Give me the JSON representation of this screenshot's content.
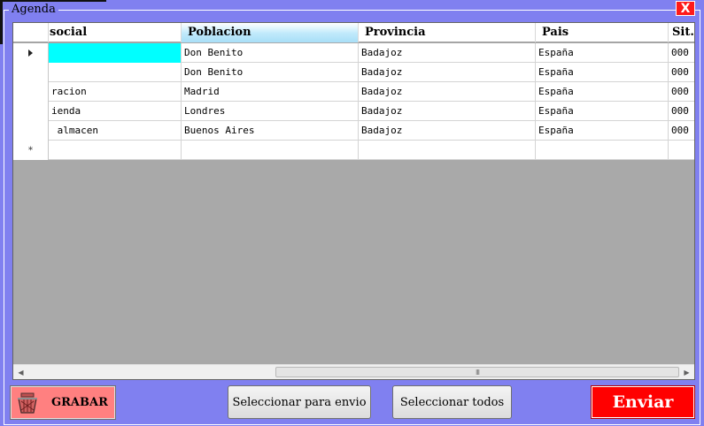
{
  "window": {
    "group_title": "Agenda",
    "close_label": "X"
  },
  "grid": {
    "columns": [
      {
        "label": "social",
        "sorted": false
      },
      {
        "label": "Poblacion",
        "sorted": true
      },
      {
        "label": "Provincia",
        "sorted": false
      },
      {
        "label": "Pais",
        "sorted": false
      },
      {
        "label": "Sit.",
        "sorted": false
      }
    ],
    "rows": [
      {
        "marker": "current",
        "social": "",
        "poblacion": "Don Benito",
        "provincia": "Badajoz",
        "pais": "España",
        "sit": "000"
      },
      {
        "marker": "",
        "social": "",
        "poblacion": "Don Benito",
        "provincia": "Badajoz",
        "pais": "España",
        "sit": "000"
      },
      {
        "marker": "",
        "social": "racion",
        "poblacion": "Madrid",
        "provincia": "Badajoz",
        "pais": "España",
        "sit": "000"
      },
      {
        "marker": "",
        "social": "ienda",
        "poblacion": "Londres",
        "provincia": "Badajoz",
        "pais": "España",
        "sit": "000"
      },
      {
        "marker": "",
        "social": " almacen",
        "poblacion": "Buenos Aires",
        "provincia": "Badajoz",
        "pais": "España",
        "sit": "000"
      }
    ],
    "new_row_marker": "*",
    "scrollbar_grip": "III"
  },
  "buttons": {
    "grabar": "GRABAR",
    "select_envio": "Seleccionar para envio",
    "select_todos": "Seleccionar todos",
    "enviar": "Enviar"
  },
  "colors": {
    "background": "#8080f0",
    "grabar_bg": "#ff8080",
    "enviar_bg": "#ff0000",
    "selected_cell": "#00ffff",
    "grid_empty": "#a9a9a9"
  },
  "icons": {
    "grabar": "save-basket-icon",
    "close": "close-icon",
    "current_row": "row-pointer-icon",
    "scroll_left": "scroll-left-icon",
    "scroll_right": "scroll-right-icon"
  }
}
